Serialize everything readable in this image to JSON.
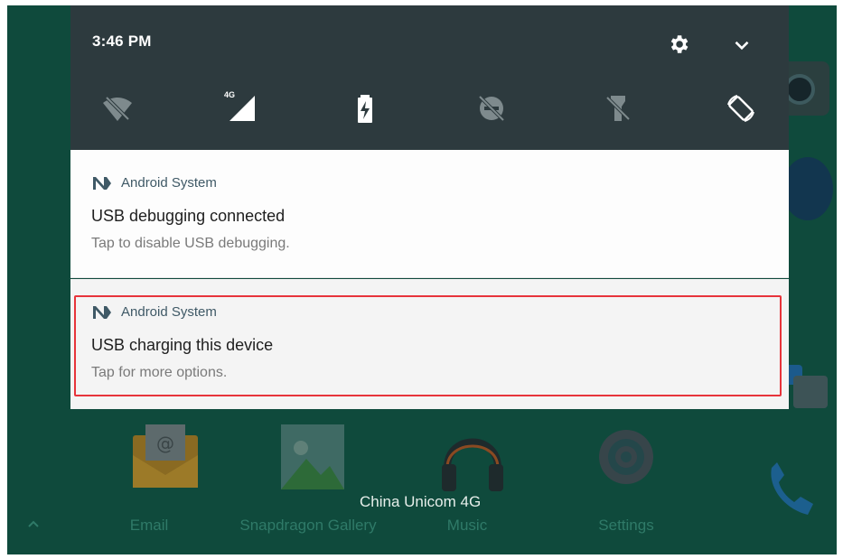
{
  "status_bar": {
    "time": "3:46 PM",
    "network_badge": "4G"
  },
  "quick_settings": {
    "tiles": [
      {
        "icon": "wifi-off-icon"
      },
      {
        "icon": "cellular-signal-icon"
      },
      {
        "icon": "battery-charging-icon"
      },
      {
        "icon": "do-not-disturb-off-icon"
      },
      {
        "icon": "flashlight-off-icon"
      },
      {
        "icon": "auto-rotate-icon"
      }
    ]
  },
  "notifications": [
    {
      "app": "Android System",
      "title": "USB debugging connected",
      "text": "Tap to disable USB debugging."
    },
    {
      "app": "Android System",
      "title": "USB charging this device",
      "text": "Tap for more options."
    }
  ],
  "home": {
    "carrier": "China Unicom 4G",
    "apps": [
      {
        "label": "Email"
      },
      {
        "label": "Snapdragon Gallery"
      },
      {
        "label": "Music"
      },
      {
        "label": "Settings"
      }
    ]
  },
  "colors": {
    "shade_bg": "#2d3a3e",
    "highlight": "#e7343b",
    "home_bg": "#0f4a3c"
  }
}
